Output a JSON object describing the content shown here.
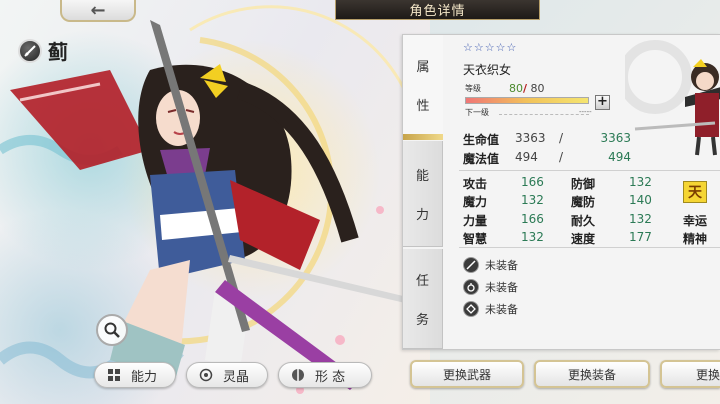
{
  "header": {
    "title": "角色详情",
    "back_icon": "←"
  },
  "character": {
    "name": "蓟",
    "name_icon": "katana-icon",
    "class_name": "天衣织女",
    "stars": "☆☆☆☆☆"
  },
  "level": {
    "label": "等级",
    "current": "80",
    "separator": "/",
    "max": "80",
    "progress": 1.0,
    "plus_label": "+",
    "next_label": "下一级",
    "next_value": "-----"
  },
  "hp": {
    "label": "生命值",
    "current": "3363",
    "separator": "/",
    "max": "3363"
  },
  "mp": {
    "label": "魔法值",
    "current": "494",
    "separator": "/",
    "max": "494"
  },
  "tabs": [
    {
      "label_1": "属",
      "label_2": "性"
    },
    {
      "label_1": "能",
      "label_2": "力"
    },
    {
      "label_1": "任",
      "label_2": "务"
    }
  ],
  "stats": {
    "col1": [
      {
        "label": "攻击",
        "value": "166"
      },
      {
        "label": "魔力",
        "value": "132"
      },
      {
        "label": "力量",
        "value": "166"
      },
      {
        "label": "智慧",
        "value": "132"
      }
    ],
    "col2": [
      {
        "label": "防御",
        "value": "132"
      },
      {
        "label": "魔防",
        "value": "140"
      },
      {
        "label": "耐久",
        "value": "132"
      },
      {
        "label": "速度",
        "value": "177"
      }
    ],
    "col3": [
      {
        "label": "幸运"
      },
      {
        "label": "精神"
      }
    ]
  },
  "title_badge": "天",
  "equipment": [
    {
      "icon": "sword-slot-icon",
      "label": "未装备"
    },
    {
      "icon": "accessory-slot-icon",
      "label": "未装备"
    },
    {
      "icon": "armor-slot-icon",
      "label": "未装备"
    }
  ],
  "bottom_left": {
    "ability_label": "能力",
    "crystal_label": "灵晶",
    "form_label": "形 态"
  },
  "bottom_buttons": {
    "weapon": "更换武器",
    "equipment": "更换装备",
    "third": "更换"
  },
  "colors": {
    "accent_gold": "#c7a44a",
    "stat_value_green": "#2b7a55",
    "title_bar_bg": "#2a2420",
    "level_sep_red": "#b41d1d"
  }
}
